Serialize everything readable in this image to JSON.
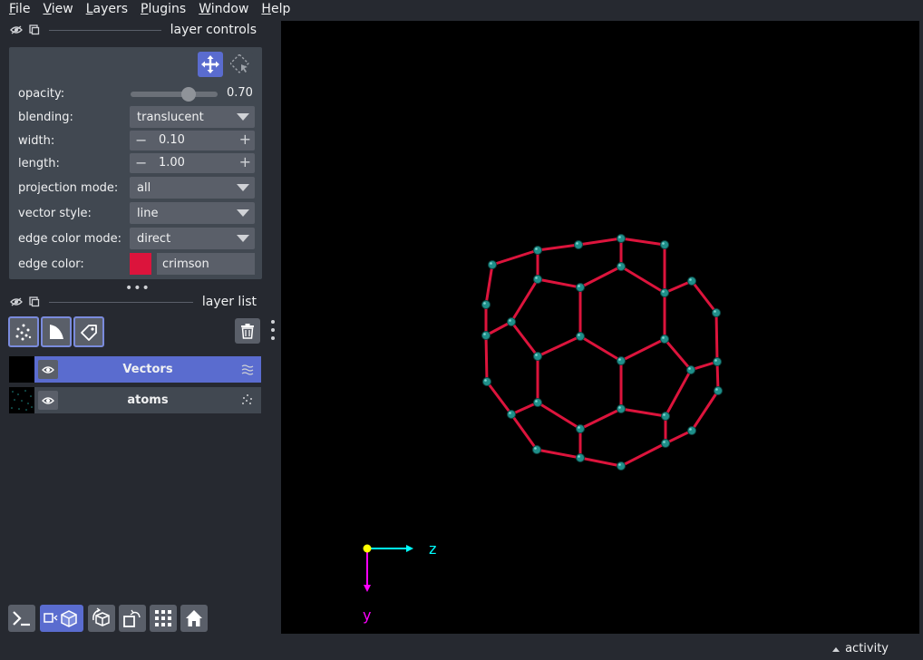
{
  "menu": [
    {
      "underline": "F",
      "rest": "ile"
    },
    {
      "underline": "V",
      "rest": "iew"
    },
    {
      "underline": "L",
      "rest": "ayers"
    },
    {
      "underline": "P",
      "rest": "lugins"
    },
    {
      "underline": "W",
      "rest": "indow"
    },
    {
      "underline": "H",
      "rest": "elp"
    }
  ],
  "layer_controls": {
    "title": "layer controls",
    "opacity_label": "opacity:",
    "opacity_value": "0.70",
    "opacity_fraction": 0.7,
    "blending_label": "blending:",
    "blending_value": "translucent",
    "width_label": "width:",
    "width_value": "0.10",
    "length_label": "length:",
    "length_value": "1.00",
    "projection_label": "projection mode:",
    "projection_value": "all",
    "vector_style_label": "vector style:",
    "vector_style_value": "line",
    "edge_color_mode_label": "edge color mode:",
    "edge_color_mode_value": "direct",
    "edge_color_label": "edge color:",
    "edge_color_value": "crimson",
    "edge_color_hex": "#dc143c"
  },
  "layer_list": {
    "title": "layer list",
    "layers": [
      {
        "name": "Vectors",
        "selected": true
      },
      {
        "name": "atoms",
        "selected": false
      }
    ]
  },
  "canvas": {
    "axis_z_label": "z",
    "axis_y_label": "y",
    "bond_color": "#dc143c",
    "atom_color": "#1f8f8a"
  },
  "status": {
    "activity_label": "activity"
  },
  "colors": {
    "accent": "#5a6ccf",
    "panel": "#414851",
    "background": "#262930"
  }
}
